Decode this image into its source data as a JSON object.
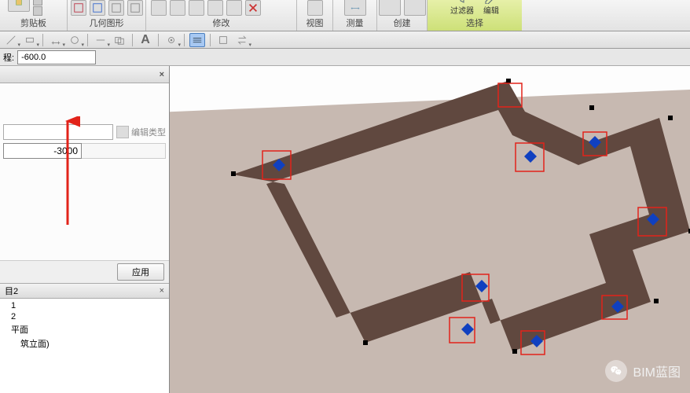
{
  "ribbon": {
    "groups": {
      "clipboard": {
        "label": "剪贴板",
        "paste": "粘贴",
        "cut": "剪切",
        "copy": ""
      },
      "geometry": {
        "label": "几何图形"
      },
      "modify": {
        "label": "修改"
      },
      "view": {
        "label": "视图"
      },
      "measure": {
        "label": "测量"
      },
      "create": {
        "label": "创建"
      },
      "select": {
        "label": "选择",
        "filter": "过滤器",
        "edit": "编辑"
      }
    }
  },
  "optbar": {
    "label": "程:",
    "value": "-600.0"
  },
  "props": {
    "edit_type": "编辑类型",
    "value": "-3000",
    "apply": "应用"
  },
  "browser": {
    "title": "目2",
    "items": [
      "1",
      "2",
      "平面",
      "筑立面)"
    ]
  },
  "watermark": {
    "text": "BIM蓝图"
  }
}
